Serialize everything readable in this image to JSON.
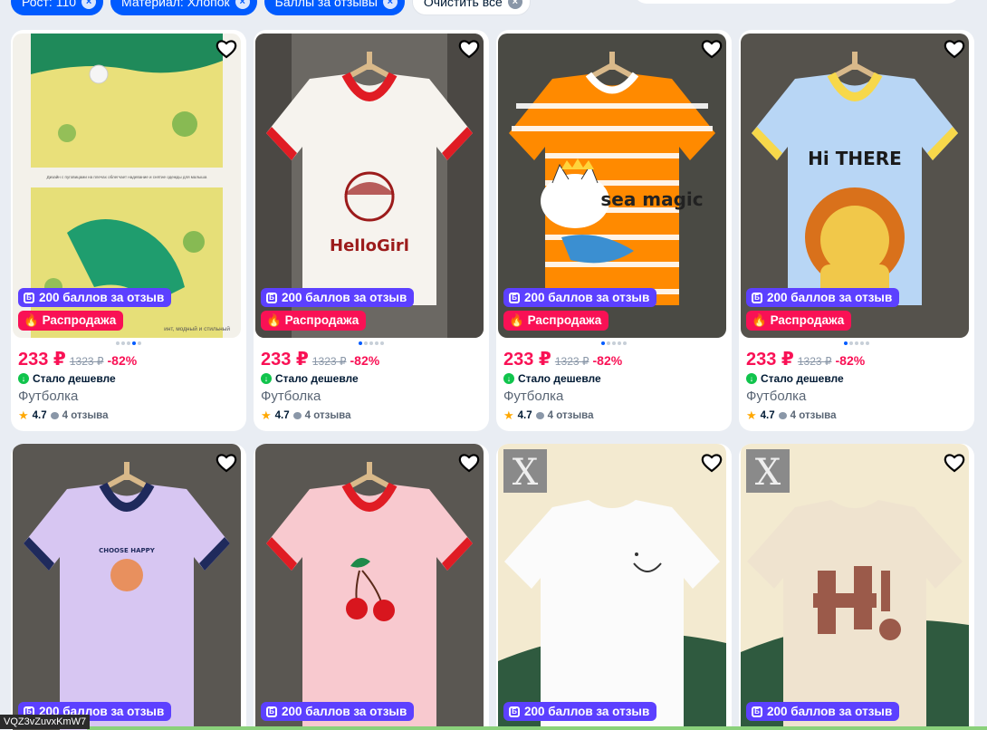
{
  "filters": {
    "chips": [
      "Рост: 110",
      "Материал: Хлопок",
      "Баллы за отзывы"
    ],
    "clear_label": "Очистить все"
  },
  "icons": {
    "favorite": "heart-icon",
    "bonus": "bonus-icon",
    "sale": "fire-icon",
    "cheaper": "arrow-down-icon",
    "star": "star-icon",
    "reviews": "chat-bubble-icon"
  },
  "colors": {
    "accent": "#005bff",
    "price": "#f91155",
    "bonus_badge": "#5c40ff",
    "sale_badge": "#f91155",
    "cheaper": "#10c44c"
  },
  "products": [
    {
      "bonus": "200 баллов за отзыв",
      "sale": "Распродажа",
      "price": "233 ₽",
      "old_price": "1323 ₽",
      "discount": "-82%",
      "cheaper": "Стало дешевле",
      "title": "Футболка",
      "rating": "4.7",
      "reviews": "4 отзыва",
      "image": "croc-shirt",
      "img_caption": "Дизайн с пуговицами на плечах облегчает надевание и снятие одежды для малыша",
      "img_caption2": "инт, модный и стильный",
      "active_dot": 3
    },
    {
      "bonus": "200 баллов за отзыв",
      "sale": "Распродажа",
      "price": "233 ₽",
      "old_price": "1323 ₽",
      "discount": "-82%",
      "cheaper": "Стало дешевле",
      "title": "Футболка",
      "rating": "4.7",
      "reviews": "4 отзыва",
      "image": "hellogirl-shirt",
      "shirt_text": "HelloGirl",
      "active_dot": 0
    },
    {
      "bonus": "200 баллов за отзыв",
      "sale": "Распродажа",
      "price": "233 ₽",
      "old_price": "1323 ₽",
      "discount": "-82%",
      "cheaper": "Стало дешевле",
      "title": "Футболка",
      "rating": "4.7",
      "reviews": "4 отзыва",
      "image": "cat-shirt",
      "shirt_text": "sea magic",
      "active_dot": 0
    },
    {
      "bonus": "200 баллов за отзыв",
      "sale": "Распродажа",
      "price": "233 ₽",
      "old_price": "1323 ₽",
      "discount": "-82%",
      "cheaper": "Стало дешевле",
      "title": "Футболка",
      "rating": "4.7",
      "reviews": "4 отзыва",
      "image": "lion-shirt",
      "shirt_text": "Hi THERE",
      "active_dot": 0
    },
    {
      "bonus": "200 баллов за отзыв",
      "image": "purple-shirt",
      "shirt_text": "CHOOSE HAPPY"
    },
    {
      "bonus": "200 баллов за отзыв",
      "image": "cherry-shirt"
    },
    {
      "bonus": "200 баллов за отзыв",
      "image": "smile-shirt",
      "logo": "X"
    },
    {
      "bonus": "200 баллов за отзыв",
      "image": "hi-shirt",
      "logo": "X"
    }
  ],
  "tooltip": "VQZ3vZuvxKmW7"
}
